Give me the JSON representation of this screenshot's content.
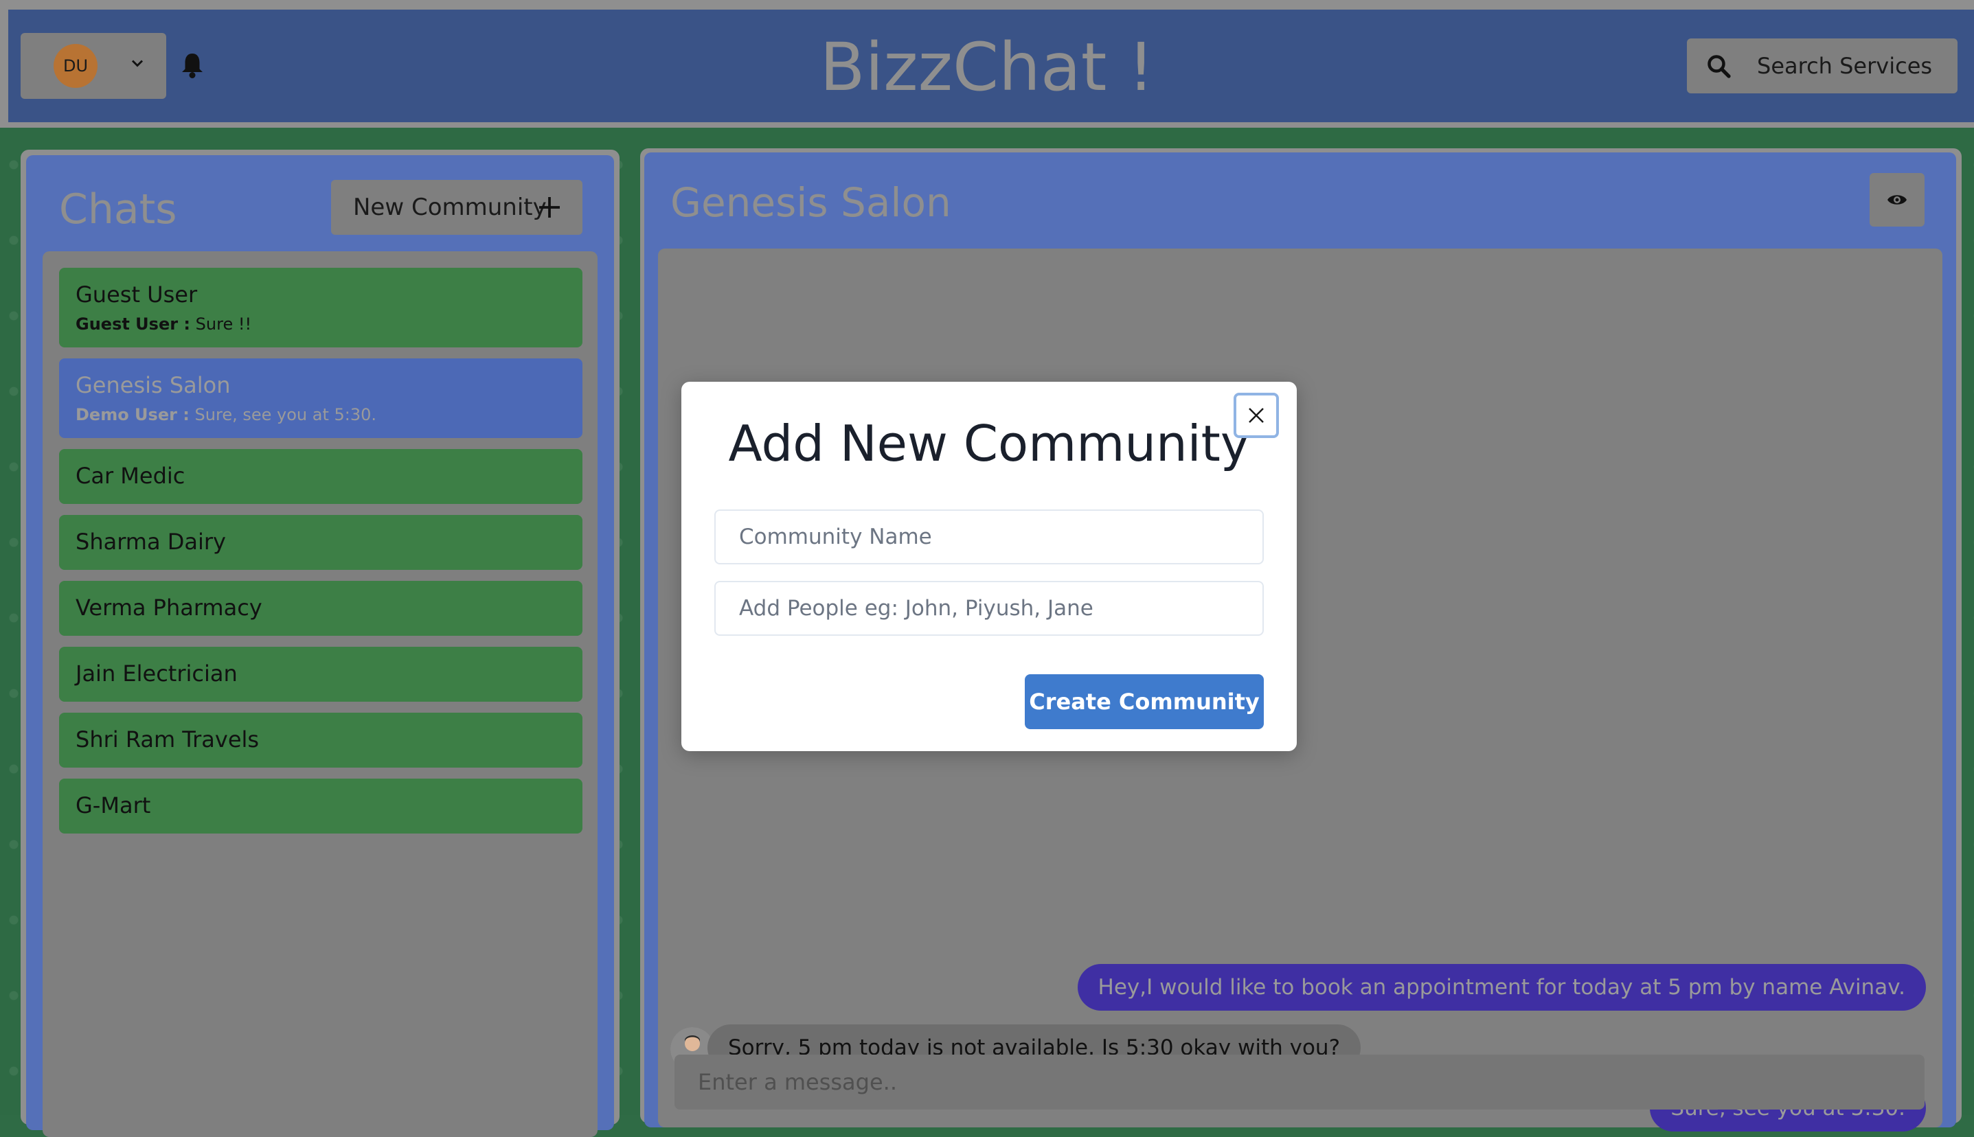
{
  "header": {
    "avatar_initials": "DU",
    "app_title": "BizzChat !",
    "search_label": "Search Services"
  },
  "sidebar": {
    "title": "Chats",
    "new_community_label": "New Community",
    "chats": [
      {
        "name": "Guest User",
        "latest_sender": "Guest User :",
        "latest_text": "Sure !!"
      },
      {
        "name": "Genesis Salon",
        "latest_sender": "Demo User :",
        "latest_text": "Sure, see you at 5:30.",
        "active": true
      },
      {
        "name": "Car Medic"
      },
      {
        "name": "Sharma Dairy"
      },
      {
        "name": "Verma Pharmacy"
      },
      {
        "name": "Jain Electrician"
      },
      {
        "name": "Shri Ram Travels"
      },
      {
        "name": "G-Mart"
      }
    ]
  },
  "chat": {
    "title": "Genesis Salon",
    "messages": [
      {
        "direction": "sent",
        "text": "Hey,I would like to book an appointment for today at 5 pm by name Avinav."
      },
      {
        "direction": "received",
        "text": "Sorry, 5 pm today is not available. Is 5:30 okay with you?"
      },
      {
        "direction": "sent",
        "text": "Sure, see you at 5:30."
      }
    ],
    "input_placeholder": "Enter a message.."
  },
  "modal": {
    "title": "Add New Community",
    "name_placeholder": "Community Name",
    "people_placeholder": "Add People eg: John, Piyush, Jane",
    "submit_label": "Create Community"
  },
  "colors": {
    "header": "#3a5387",
    "panel": "#5570b8",
    "chat_item": "#3d7f46",
    "sent_bubble": "#3f2fa3",
    "primary_button": "#3f7bcd"
  },
  "icons": [
    "chevron-down-icon",
    "bell-icon",
    "search-icon",
    "plus-icon",
    "eye-icon",
    "close-icon"
  ]
}
